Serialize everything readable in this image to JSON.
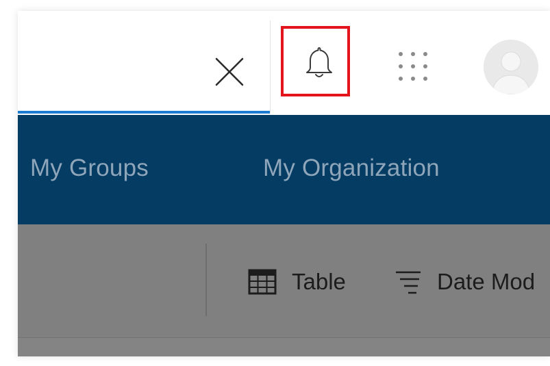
{
  "header": {
    "close_icon": "close-icon",
    "notifications_icon": "bell-icon",
    "apps_icon": "app-launcher-grid-icon",
    "avatar_icon": "user-avatar",
    "accent_color": "#1b7bd1",
    "highlight_color": "#e3141b"
  },
  "nav": {
    "background": "#043c63",
    "items": [
      {
        "label": "My Groups"
      },
      {
        "label": "My Organization"
      }
    ]
  },
  "toolbar": {
    "view_label": "Table",
    "view_icon": "table-icon",
    "sort_label": "Date Mod",
    "sort_icon": "sort-lines-icon"
  }
}
